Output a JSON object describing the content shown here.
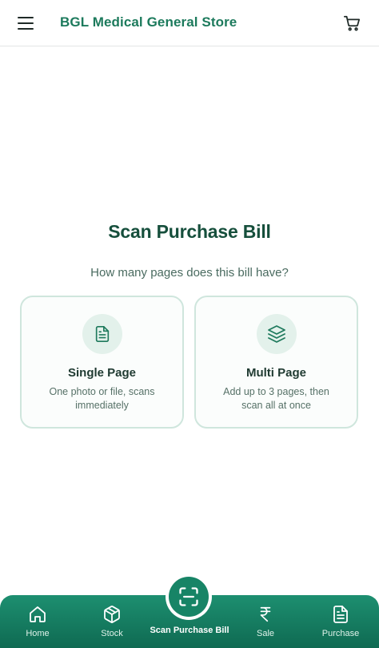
{
  "header": {
    "title": "BGL Medical General Store",
    "menu_icon": "hamburger-menu-icon",
    "cart_icon": "shopping-cart-icon"
  },
  "main": {
    "title": "Scan Purchase Bill",
    "subtitle": "How many pages does this bill have?",
    "options": [
      {
        "title": "Single Page",
        "description": "One photo or file, scans immediately",
        "icon": "document-icon"
      },
      {
        "title": "Multi Page",
        "description": "Add up to 3 pages, then scan all at once",
        "icon": "layers-icon"
      }
    ]
  },
  "bottom_nav": {
    "items": [
      {
        "label": "Home",
        "icon": "home-icon"
      },
      {
        "label": "Stock",
        "icon": "box-icon"
      },
      {
        "label": "Scan Purchase Bill",
        "icon": "scan-icon",
        "active": true
      },
      {
        "label": "Sale",
        "icon": "rupee-icon"
      },
      {
        "label": "Purchase",
        "icon": "document-icon"
      }
    ]
  },
  "colors": {
    "brand": "#1c7a5c",
    "title": "#164f3c",
    "card_border": "#cfe6dd",
    "icon_bg": "#e3f1eb",
    "nav_bg": "#178466"
  }
}
